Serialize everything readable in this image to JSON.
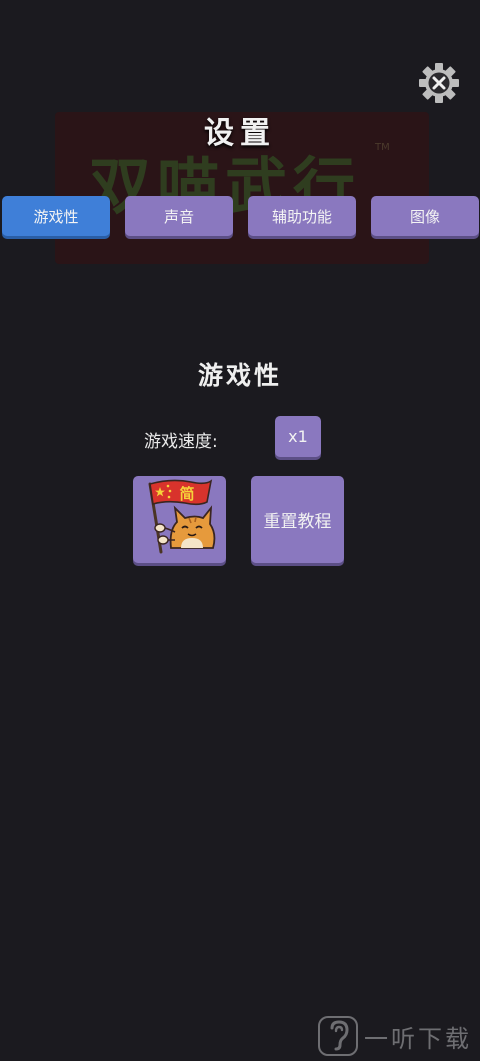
{
  "background_logo": {
    "text": "双喵武行",
    "tm": "TM"
  },
  "header": {
    "title": "设置",
    "close_icon": "close-gear-icon"
  },
  "tabs": [
    {
      "label": "游戏性",
      "active": true
    },
    {
      "label": "声音",
      "active": false
    },
    {
      "label": "辅助功能",
      "active": false
    },
    {
      "label": "图像",
      "active": false
    }
  ],
  "gameplay": {
    "section_title": "游戏性",
    "speed_label": "游戏速度:",
    "speed_value": "x1",
    "language_button": {
      "icon": "cat-with-flag-icon",
      "flag_text": "简"
    },
    "reset_tutorial_label": "重置教程"
  },
  "watermark": {
    "text": "一听下载",
    "icon": "ear-logo-icon"
  },
  "colors": {
    "background": "#1b1a1f",
    "tab_active": "#3f7fd8",
    "button_purple": "#8a78bf"
  }
}
